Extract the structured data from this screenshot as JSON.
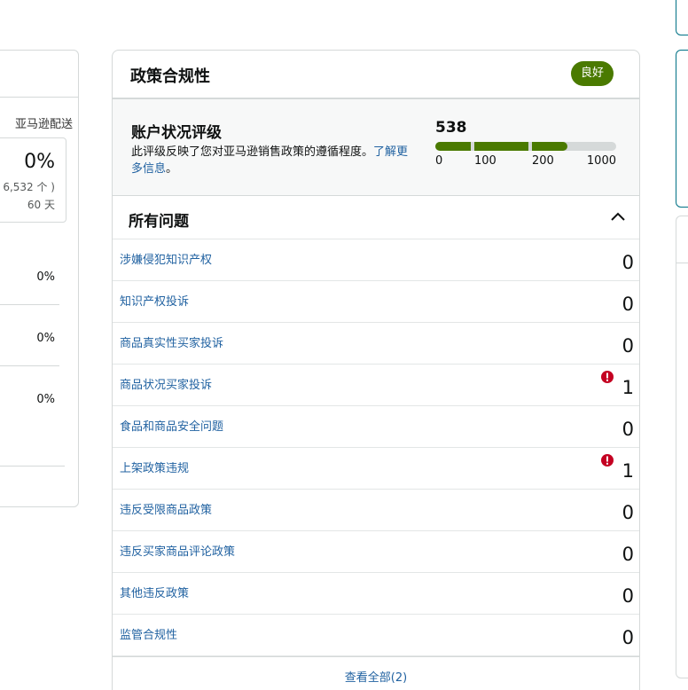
{
  "left_card": {
    "header_text": "亚马逊配送",
    "metric_value": "0%",
    "metric_count": "6,532 个 )",
    "metric_period": "60 天",
    "rows": [
      "0%",
      "0%",
      "0%"
    ]
  },
  "policy_card": {
    "title": "政策合规性",
    "status_badge": "良好",
    "rating": {
      "title": "账户状况评级",
      "description": "此评级反映了您对亚马逊销售政策的遵循程度。",
      "learn_more": "了解更多信息",
      "description_end": "。",
      "score": "538",
      "score_value": 538,
      "scale_max": 1000,
      "ticks": [
        "0",
        "100",
        "200",
        "1000"
      ]
    },
    "issues": {
      "title": "所有问题",
      "items": [
        {
          "label": "涉嫌侵犯知识产权",
          "count": "0",
          "alert": false
        },
        {
          "label": "知识产权投诉",
          "count": "0",
          "alert": false
        },
        {
          "label": "商品真实性买家投诉",
          "count": "0",
          "alert": false
        },
        {
          "label": "商品状况买家投诉",
          "count": "1",
          "alert": true
        },
        {
          "label": "食品和商品安全问题",
          "count": "0",
          "alert": false
        },
        {
          "label": "上架政策违规",
          "count": "1",
          "alert": true
        },
        {
          "label": "违反受限商品政策",
          "count": "0",
          "alert": false
        },
        {
          "label": "违反买家商品评论政策",
          "count": "0",
          "alert": false
        },
        {
          "label": "其他违反政策",
          "count": "0",
          "alert": false
        },
        {
          "label": "监管合规性",
          "count": "0",
          "alert": false
        }
      ],
      "view_all": "查看全部(2)"
    }
  },
  "colors": {
    "good_green": "#4a7a00",
    "link_blue": "#2162a1",
    "alert_red": "#c40022",
    "track_gray": "#d5d9d9"
  }
}
